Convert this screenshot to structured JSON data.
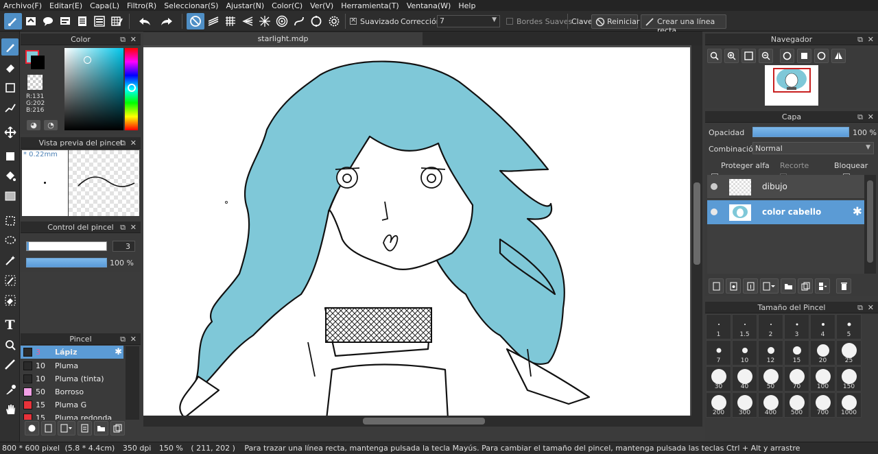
{
  "menu": [
    "Archivo(F)",
    "Editar(E)",
    "Capa(L)",
    "Filtro(R)",
    "Seleccionar(S)",
    "Ajustar(N)",
    "Color(C)",
    "Ver(V)",
    "Herramienta(T)",
    "Ventana(W)",
    "Help"
  ],
  "toolbar": {
    "suavizado_label": "Suavizado",
    "correccion_label": "Corrección",
    "correccion_value": "7",
    "bordes_label": "Bordes Suaves",
    "clave_label": "Clave",
    "reiniciar_label": "Reiniciar",
    "linea_recta_label": "Crear una línea recta"
  },
  "color_panel": {
    "title": "Color",
    "r": "R:131",
    "g": "G:202",
    "b": "B:216",
    "fg_color": "#83CAD8"
  },
  "brush_preview": {
    "title": "Vista previa del pincel",
    "size": "* 0.22mm"
  },
  "brush_control": {
    "title": "Control del pincel",
    "size_value": "3",
    "opacity_value": "100 %"
  },
  "brush_list": {
    "title": "Pincel",
    "items": [
      {
        "size": "3",
        "name": "Lápiz",
        "color": "#2a2a2a",
        "selected": true
      },
      {
        "size": "10",
        "name": "Pluma",
        "color": "#2a2a2a"
      },
      {
        "size": "10",
        "name": "Pluma (tinta)",
        "color": "#2a2a2a"
      },
      {
        "size": "50",
        "name": "Borroso",
        "color": "#f2a0e6"
      },
      {
        "size": "15",
        "name": "Pluma G",
        "color": "#e8323a"
      },
      {
        "size": "15",
        "name": "Pluma redonda",
        "color": "#e8323a"
      }
    ]
  },
  "canvas": {
    "tab_title": "starlight.mdp",
    "hair_color": "#7FC8D8"
  },
  "navigator": {
    "title": "Navegador"
  },
  "layers": {
    "title": "Capa",
    "opacity_label": "Opacidad",
    "opacity_value": "100 %",
    "blend_label": "Combinación",
    "blend_value": "Normal",
    "protect_alpha": "Proteger alfa",
    "clip": "Recorte",
    "lock": "Bloquear",
    "items": [
      {
        "name": "dibujo",
        "selected": false
      },
      {
        "name": "color cabello",
        "selected": true
      }
    ]
  },
  "brush_size": {
    "title": "Tamaño del Pincel",
    "sizes": [
      "1",
      "1.5",
      "2",
      "3",
      "4",
      "5",
      "7",
      "10",
      "12",
      "15",
      "20",
      "25",
      "30",
      "40",
      "50",
      "70",
      "100",
      "150",
      "200",
      "300",
      "400",
      "500",
      "700",
      "1000"
    ]
  },
  "status": {
    "canvas_size": "800 * 600 pixel",
    "physical": "(5.8 * 4.4cm)",
    "dpi": "350 dpi",
    "zoom": "150 %",
    "coords": "( 211, 202 )",
    "hint": "Para trazar una línea recta, mantenga pulsada la tecla Mayús. Para cambiar el tamaño del pincel, mantenga pulsada las teclas Ctrl + Alt y arrastre"
  },
  "colors": {
    "accent": "#4F8FC6",
    "selected_row": "#5B9BD5"
  }
}
